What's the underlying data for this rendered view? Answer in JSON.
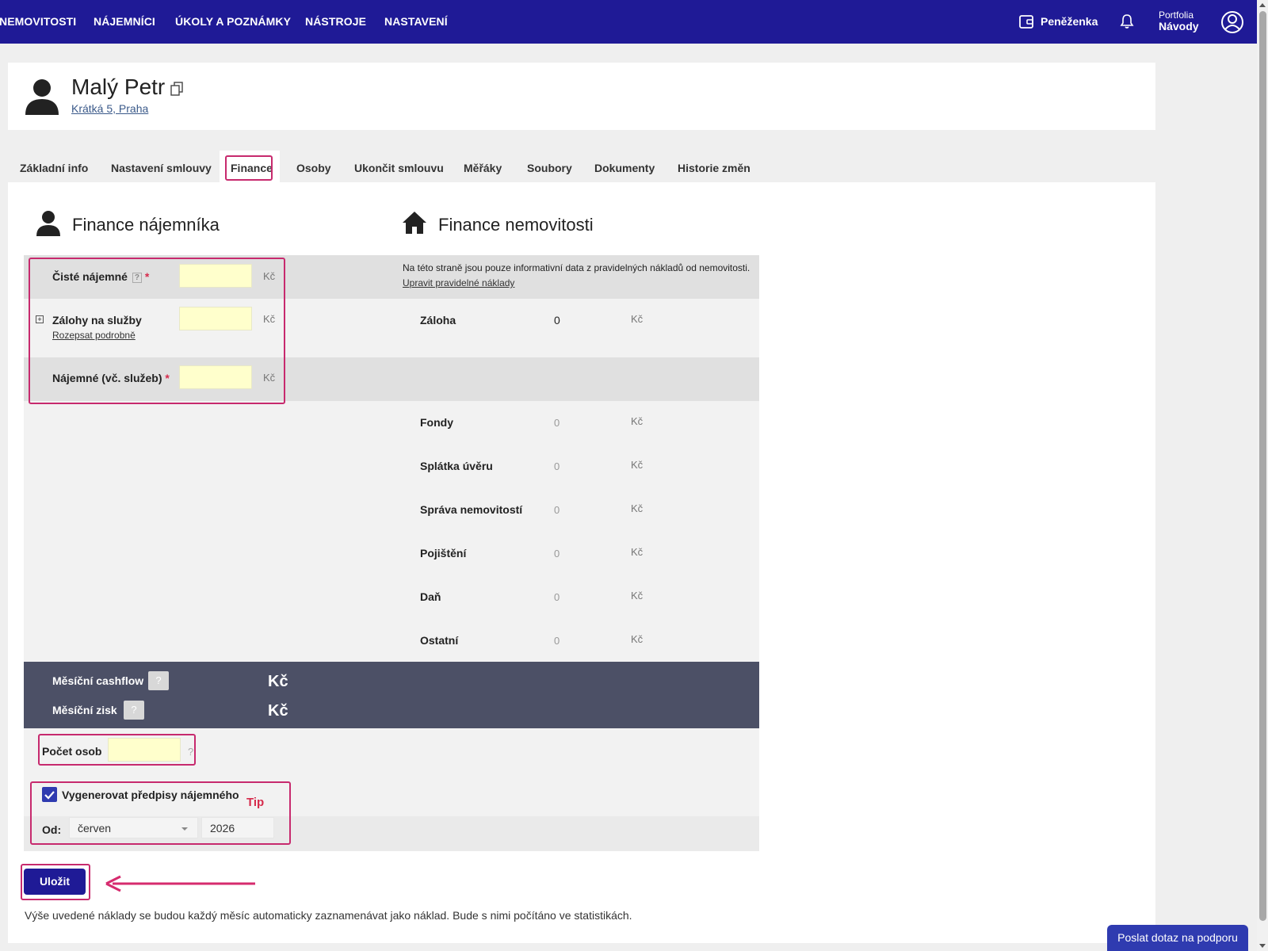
{
  "nav": {
    "items": [
      "NEMOVITOSTI",
      "NÁJEMNÍCI",
      "ÚKOLY A POZNÁMKY",
      "NÁSTROJE",
      "NASTAVENÍ"
    ],
    "wallet": "Peněženka",
    "portfolio_label": "Portfolia",
    "portfolio_value": "Návody"
  },
  "tenant": {
    "name": "Malý Petr",
    "address": "Krátká 5, Praha"
  },
  "tabs": [
    "Základní info",
    "Nastavení smlouvy",
    "Finance",
    "Osoby",
    "Ukončit smlouvu",
    "Měřáky",
    "Soubory",
    "Dokumenty",
    "Historie změn"
  ],
  "active_tab": "Finance",
  "tenant_finance": {
    "title": "Finance nájemníka",
    "net_rent_label": "Čisté nájemné",
    "deposits_label": "Zálohy na služby",
    "deposits_link": "Rozepsat podrobně",
    "total_rent_label": "Nájemné (vč. služeb)",
    "currency": "Kč",
    "required_mark": "*",
    "help_mark": "?"
  },
  "property_finance": {
    "title": "Finance nemovitosti",
    "info": "Na této straně jsou pouze informativní data z pravidelných nákladů od nemovitosti.",
    "info_link": "Upravit pravidelné náklady",
    "deposit_label": "Záloha",
    "deposit_value": "0",
    "costs": [
      {
        "label": "Fondy",
        "value": "0"
      },
      {
        "label": "Splátka úvěru",
        "value": "0"
      },
      {
        "label": "Správa nemovitostí",
        "value": "0"
      },
      {
        "label": "Pojištění",
        "value": "0"
      },
      {
        "label": "Daň",
        "value": "0"
      },
      {
        "label": "Ostatní",
        "value": "0"
      }
    ],
    "currency": "Kč"
  },
  "summary": {
    "cashflow_label": "Měsíční cashflow",
    "profit_label": "Měsíční zisk",
    "currency": "Kč",
    "help_mark": "?"
  },
  "persons": {
    "label": "Počet osob",
    "help_mark": "?"
  },
  "generate": {
    "label": "Vygenerovat předpisy nájemného",
    "checked": true,
    "from_label": "Od:",
    "month": "červen",
    "year": "2026",
    "tip": "Tip"
  },
  "save_label": "Uložit",
  "footer_note": "Výše uvedené náklady se budou každý měsíc automaticky zaznamenávat jako náklad. Bude s nimi počítáno ve statistikách.",
  "support_label": "Poslat dotaz na podporu",
  "colors": {
    "nav": "#1f1a96",
    "highlight": "#c72a6e",
    "input_bg": "#ffffcc",
    "summary_bar": "#4c5066"
  }
}
